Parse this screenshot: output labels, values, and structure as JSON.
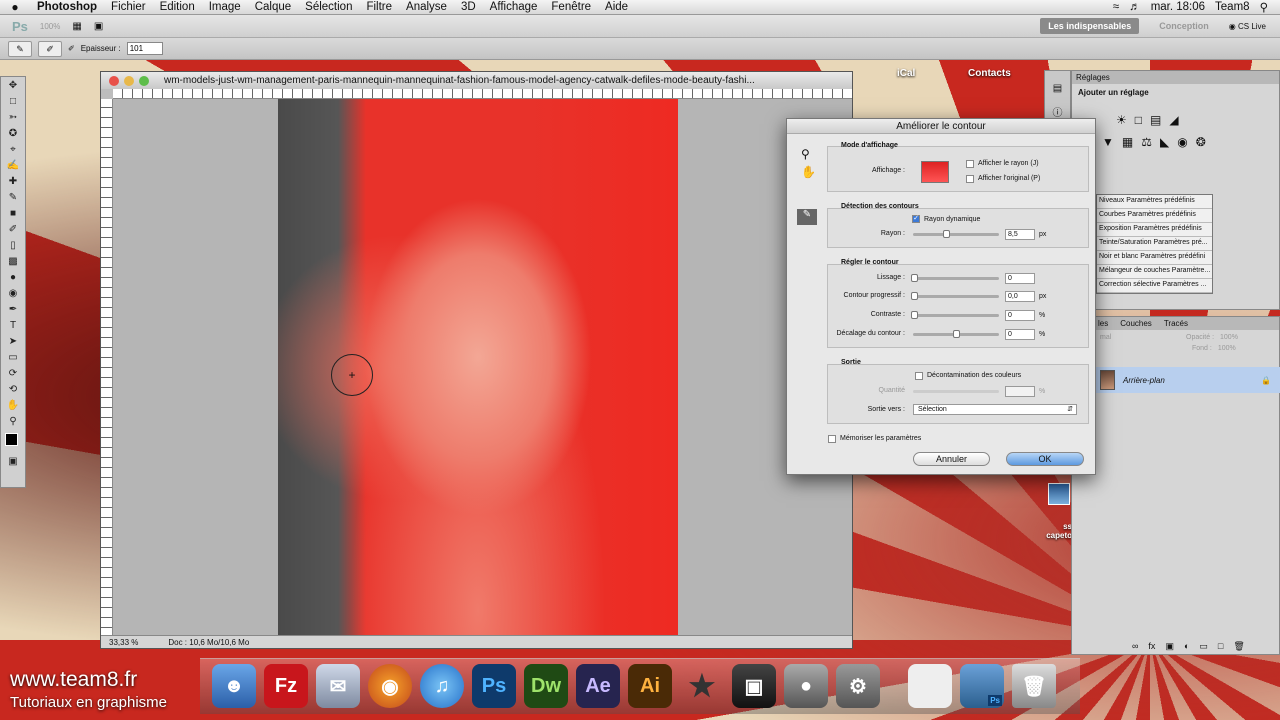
{
  "menubar": {
    "apple": "",
    "app": "Photoshop",
    "items": [
      "Fichier",
      "Edition",
      "Image",
      "Calque",
      "Sélection",
      "Filtre",
      "Analyse",
      "3D",
      "Affichage",
      "Fenêtre",
      "Aide"
    ],
    "clock": "mar. 18:06",
    "user": "Team8"
  },
  "appbar": {
    "logo": "Ps",
    "zoom": "100%",
    "workspace_active": "Les indispensables",
    "workspace_other": "Conception",
    "cslive": "CS Live"
  },
  "optbar": {
    "epaisseur_label": "Epaisseur :",
    "epaisseur_value": "101"
  },
  "document": {
    "title": "wm-models-just-wm-management-paris-mannequin-mannequinat-fashion-famous-model-agency-catwalk-defiles-mode-beauty-fashi...",
    "zoom": "33,33 %",
    "doc_info": "Doc : 10,6 Mo/10,6 Mo"
  },
  "desktop": {
    "ical": "iCal",
    "contacts": "Contacts",
    "screenshot_label": "ss capeto"
  },
  "panels": {
    "reglages_tab": "Réglages",
    "ajouter": "Ajouter un réglage",
    "presets": [
      "Niveaux Paramètres prédéfinis",
      "Courbes Paramètres prédéfinis",
      "Exposition Paramètres prédéfinis",
      "Teinte/Saturation Paramètres pré...",
      "Noir et blanc Paramètres prédéfini",
      "Mélangeur de couches Paramètre...",
      "Correction sélective Paramètres ..."
    ],
    "layer_tabs": [
      "les",
      "Couches",
      "Tracés"
    ],
    "blend": "mal",
    "opacity_label": "Opacité :",
    "opacity": "100%",
    "fill_label": "Fond :",
    "fill": "100%",
    "layer_name": "Arrière-plan"
  },
  "dialog": {
    "title": "Améliorer le contour",
    "mode": {
      "title": "Mode d'affichage",
      "affichage_label": "Affichage :",
      "show_radius": "Afficher le rayon (J)",
      "show_original": "Afficher l'original (P)"
    },
    "detection": {
      "title": "Détection des contours",
      "dynamic": "Rayon dynamique",
      "rayon_label": "Rayon :",
      "rayon_value": "8,5",
      "rayon_unit": "px"
    },
    "adjust": {
      "title": "Régler le contour",
      "lissage_label": "Lissage :",
      "lissage_value": "0",
      "progressif_label": "Contour progressif :",
      "progressif_value": "0,0",
      "progressif_unit": "px",
      "contraste_label": "Contraste :",
      "contraste_value": "0",
      "contraste_unit": "%",
      "decalage_label": "Décalage du contour :",
      "decalage_value": "0",
      "decalage_unit": "%"
    },
    "output": {
      "title": "Sortie",
      "decontam": "Décontamination des couleurs",
      "quantite_label": "Quantité",
      "quantite_unit": "%",
      "sortie_vers_label": "Sortie vers :",
      "sortie_vers_value": "Sélection"
    },
    "remember": "Mémoriser les paramètres",
    "cancel": "Annuler",
    "ok": "OK"
  },
  "dock": {
    "filezilla": "Fz",
    "ps": "Ps",
    "dw": "Dw",
    "ae": "Ae",
    "ai": "Ai",
    "stack_badge": "Ps"
  },
  "brand": {
    "url": "www.team8.fr",
    "subtitle": "Tutoriaux en graphisme"
  }
}
